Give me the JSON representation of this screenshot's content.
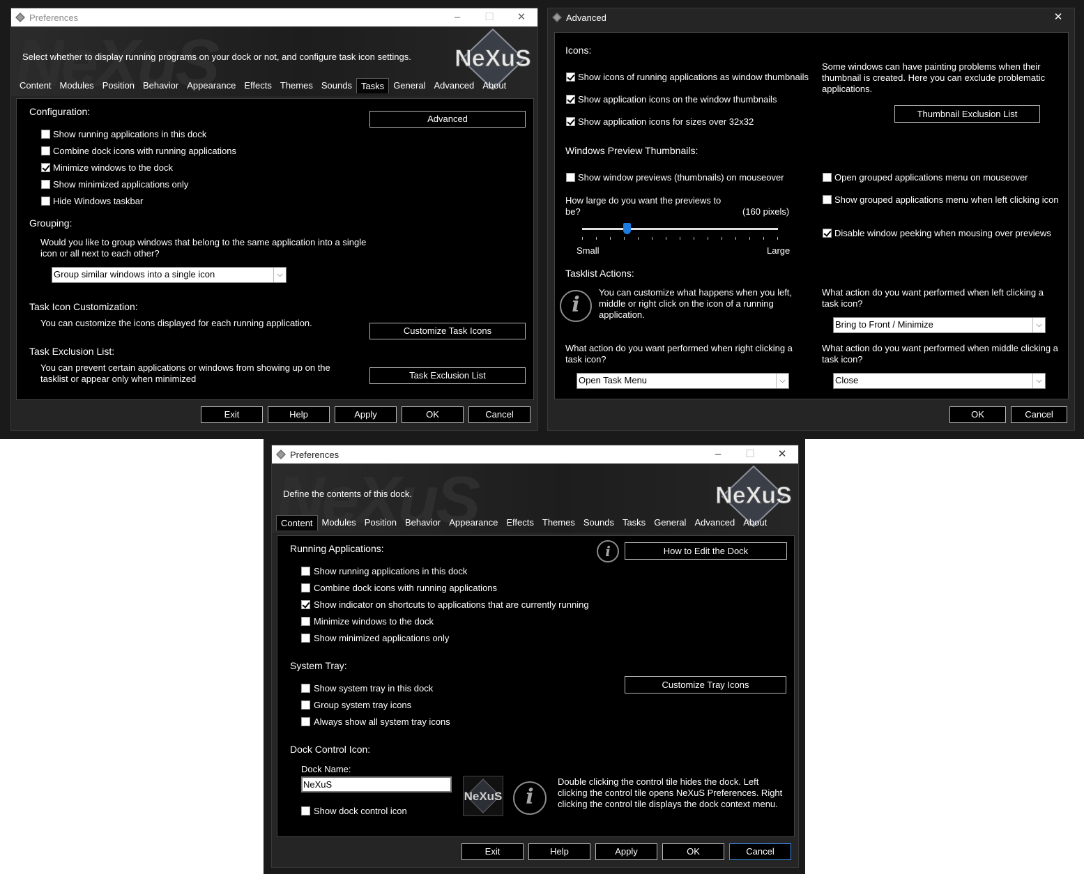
{
  "window1": {
    "title": "Preferences",
    "description": "Select whether to display running programs on your dock or not, and configure task icon settings.",
    "logo_icon": "nexus-logo-icon",
    "tabs": [
      "Content",
      "Modules",
      "Position",
      "Behavior",
      "Appearance",
      "Effects",
      "Themes",
      "Sounds",
      "Tasks",
      "General",
      "Advanced",
      "About"
    ],
    "active_tab": "Tasks",
    "configuration": {
      "heading": "Configuration:",
      "advanced_button": "Advanced",
      "checkboxes": [
        {
          "label": "Show running applications in this dock",
          "checked": false
        },
        {
          "label": "Combine dock icons with running applications",
          "checked": false
        },
        {
          "label": "Minimize windows to the dock",
          "checked": true
        },
        {
          "label": "Show minimized applications only",
          "checked": false
        },
        {
          "label": "Hide Windows taskbar",
          "checked": false
        }
      ]
    },
    "grouping": {
      "heading": "Grouping:",
      "question": "Would you like to group windows that belong to the same application into a single icon or all next to each other?",
      "select_value": "Group similar windows into a single icon"
    },
    "task_icon": {
      "heading": "Task Icon Customization:",
      "text": "You can customize the icons displayed for each running application.",
      "button": "Customize Task Icons"
    },
    "task_exclusion": {
      "heading": "Task Exclusion List:",
      "text": "You can prevent certain applications or windows from showing up on the tasklist or appear only when minimized",
      "button": "Task Exclusion List"
    },
    "footer_buttons": [
      "Exit",
      "Help",
      "Apply",
      "OK",
      "Cancel"
    ]
  },
  "window2": {
    "title": "Advanced",
    "icons": {
      "heading": "Icons:",
      "checkboxes": [
        {
          "label": "Show icons of running applications as window thumbnails",
          "checked": true
        },
        {
          "label": "Show application icons on the window thumbnails",
          "checked": true
        },
        {
          "label": "Show application icons for sizes over 32x32",
          "checked": true
        }
      ],
      "exclusion_text": "Some windows can have painting problems when their thumbnail is created. Here you can exclude problematic applications.",
      "exclusion_button": "Thumbnail Exclusion List"
    },
    "preview": {
      "heading": "Windows Preview Thumbnails:",
      "show_previews": {
        "label": "Show window previews (thumbnails) on mouseover",
        "checked": false
      },
      "size_question": "How large do you want the previews to be?",
      "size_value": "(160 pixels)",
      "slider_min_label": "Small",
      "slider_max_label": "Large",
      "slider_fraction": 0.22,
      "open_grouped": {
        "label": "Open grouped applications menu on mouseover",
        "checked": false
      },
      "show_grouped": {
        "label": "Show grouped applications menu when left clicking icon",
        "checked": false
      },
      "disable_peek": {
        "label": "Disable window peeking when mousing over previews",
        "checked": true
      }
    },
    "tasklist": {
      "heading": "Tasklist Actions:",
      "info_text": "You can customize what happens when you left, middle or right click on the icon of a running application.",
      "left_question": "What action do you want performed when left clicking a task icon?",
      "left_value": "Bring to Front / Minimize",
      "right_question": "What action do you want performed when right clicking a task icon?",
      "right_value": "Open Task Menu",
      "middle_question": "What action do you want performed when middle clicking a task icon?",
      "middle_value": "Close"
    },
    "footer_buttons": [
      "OK",
      "Cancel"
    ]
  },
  "window3": {
    "title": "Preferences",
    "description": "Define the contents of this dock.",
    "tabs": [
      "Content",
      "Modules",
      "Position",
      "Behavior",
      "Appearance",
      "Effects",
      "Themes",
      "Sounds",
      "Tasks",
      "General",
      "Advanced",
      "About"
    ],
    "active_tab": "Content",
    "running": {
      "heading": "Running Applications:",
      "help_button": "How to Edit the Dock",
      "checkboxes": [
        {
          "label": "Show running applications in this dock",
          "checked": false
        },
        {
          "label": "Combine dock icons with running applications",
          "checked": false
        },
        {
          "label": "Show indicator on shortcuts to applications that are currently running",
          "checked": true
        },
        {
          "label": "Minimize windows to the dock",
          "checked": false
        },
        {
          "label": "Show minimized applications only",
          "checked": false
        }
      ]
    },
    "tray": {
      "heading": "System Tray:",
      "button": "Customize Tray Icons",
      "checkboxes": [
        {
          "label": "Show system tray in this dock",
          "checked": false
        },
        {
          "label": "Group system tray icons",
          "checked": false
        },
        {
          "label": "Always show all system tray icons",
          "checked": false
        }
      ]
    },
    "control": {
      "heading": "Dock Control Icon:",
      "name_label": "Dock Name:",
      "name_value": "NeXuS",
      "show_icon": {
        "label": "Show dock control icon",
        "checked": false
      },
      "info_text": "Double clicking the control tile hides the dock. Left clicking the control tile opens NeXuS Preferences. Right clicking the control tile displays the dock context menu."
    },
    "footer_buttons": [
      "Exit",
      "Help",
      "Apply",
      "OK",
      "Cancel"
    ]
  }
}
